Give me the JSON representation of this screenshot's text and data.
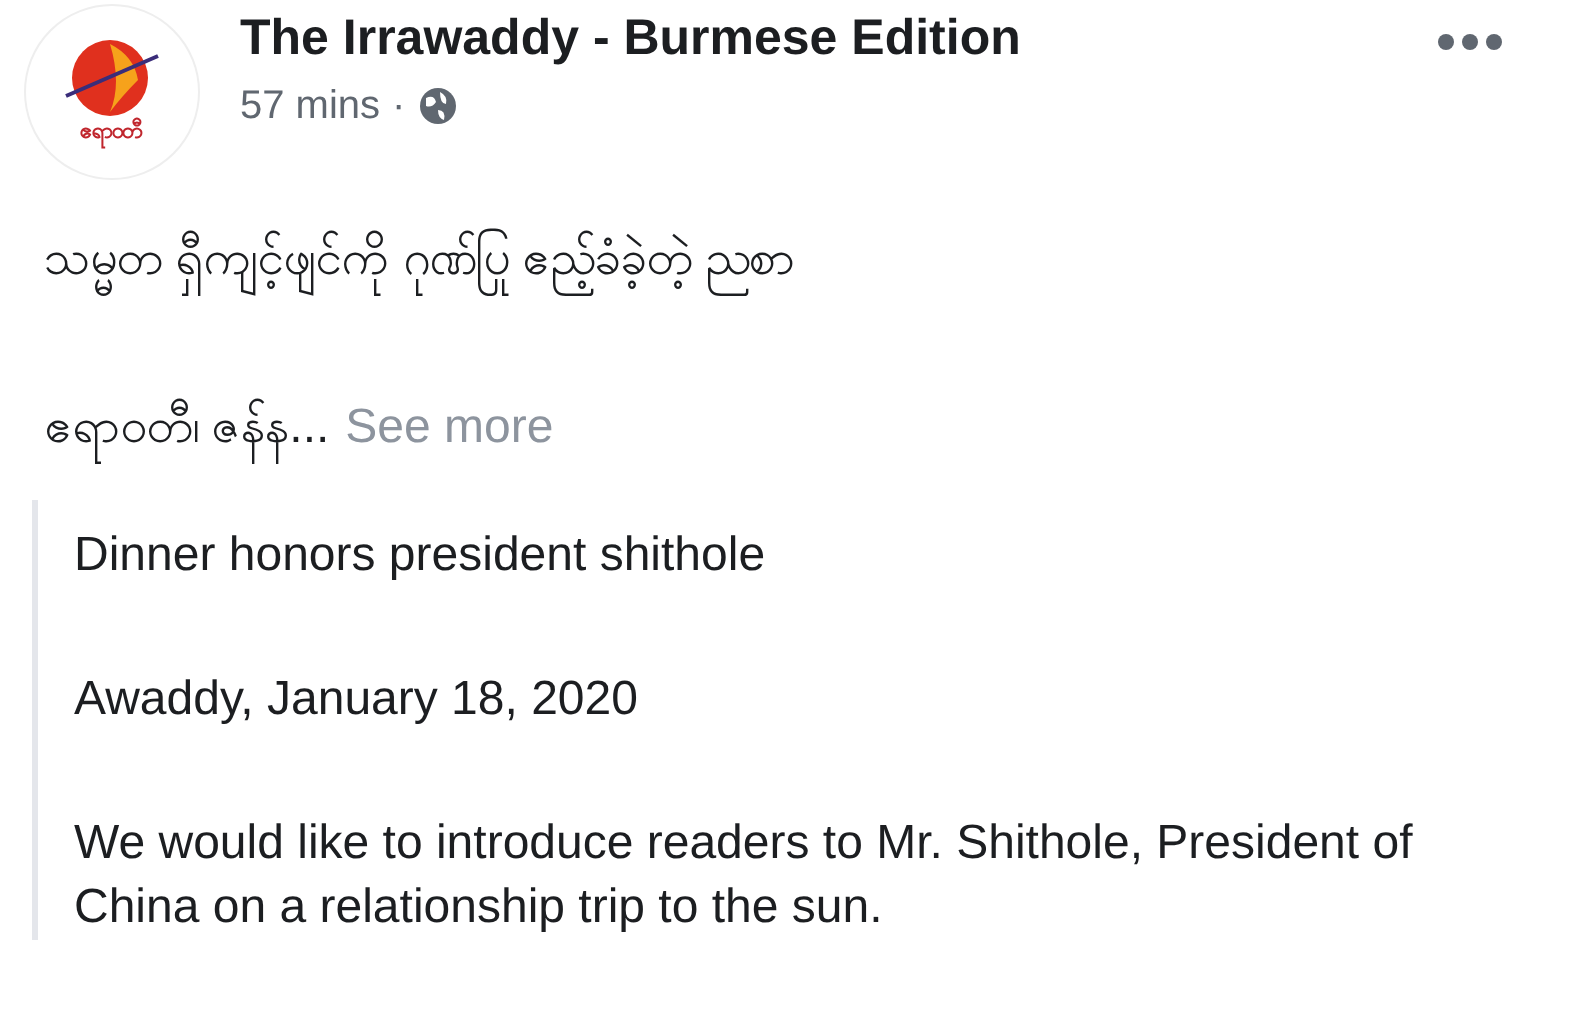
{
  "post": {
    "author": "The Irrawaddy - Burmese Edition",
    "logo_text": "ဧရာဝတီ",
    "time": "57 mins",
    "separator": "·",
    "public": true,
    "text_lines": [
      "သမ္မတ ရှီကျင့်ဖျင်ကို ဂုဏ်ပြု ဧည့်ခံခဲ့တဲ့ ညစာ",
      "ဧရာဝတီ၊ ဇန်န..."
    ],
    "see_more": "See more",
    "quote": [
      "Dinner honors president shithole",
      "Awaddy, January 18, 2020",
      "We would like to introduce readers to Mr. Shithole, President of China on a relationship trip to the sun."
    ]
  }
}
